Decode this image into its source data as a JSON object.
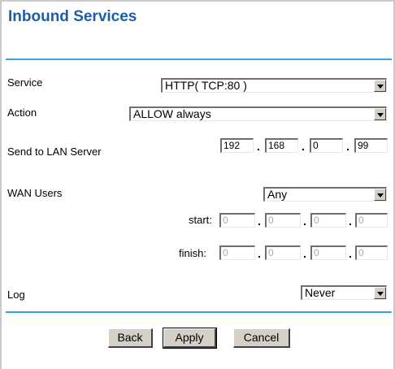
{
  "title": "Inbound Services",
  "service": {
    "label": "Service",
    "value": "HTTP( TCP:80 )"
  },
  "action": {
    "label": "Action",
    "value": "ALLOW always"
  },
  "lan_server": {
    "label": "Send to LAN Server",
    "octets": [
      "192",
      "168",
      "0",
      "99"
    ]
  },
  "wan_users": {
    "label": "WAN Users",
    "value": "Any",
    "start_label": "start:",
    "start": [
      "0",
      "0",
      "0",
      "0"
    ],
    "finish_label": "finish:",
    "finish": [
      "0",
      "0",
      "0",
      "0"
    ]
  },
  "log": {
    "label": "Log",
    "value": "Never"
  },
  "buttons": {
    "back": "Back",
    "apply": "Apply",
    "cancel": "Cancel"
  },
  "colors": {
    "title": "#1c5fa8",
    "rule": "#3ca0e0",
    "button_face": "#d4d0c8"
  }
}
